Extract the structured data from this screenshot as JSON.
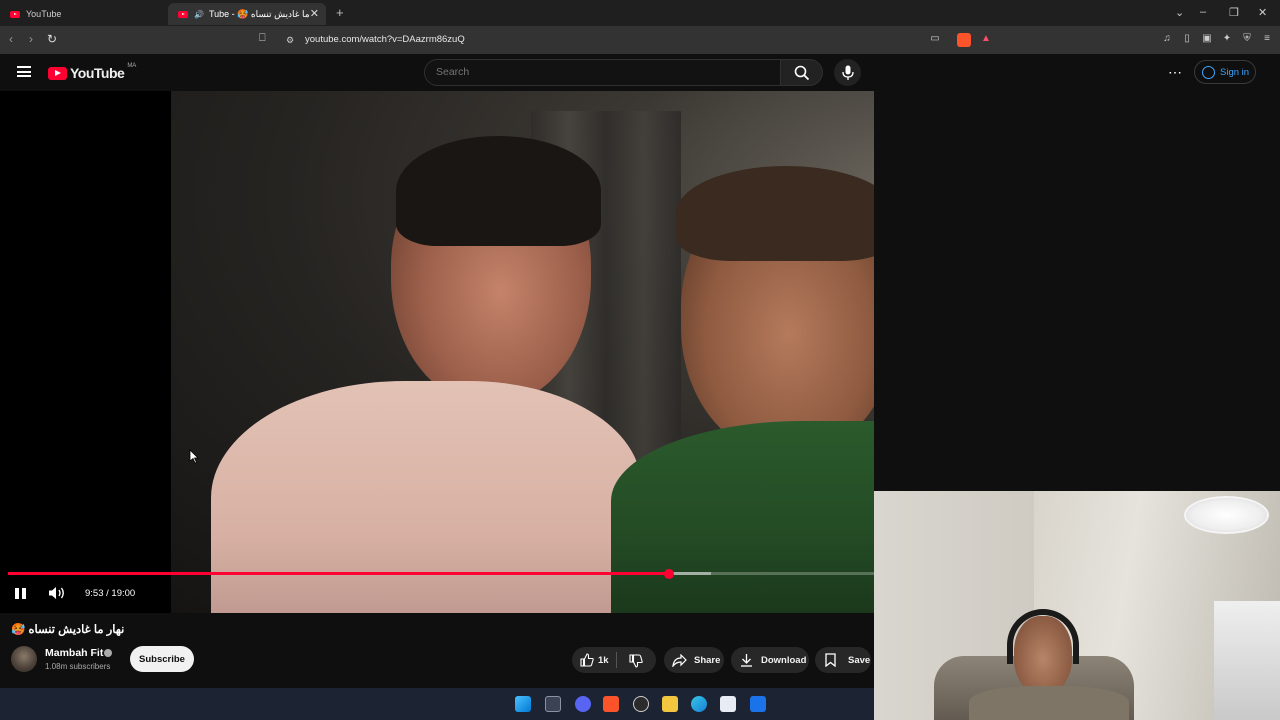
{
  "browser": {
    "tabs": [
      {
        "title": "YouTube"
      },
      {
        "title": "Tube - 🥵 نهار ما غاديش تنساه"
      }
    ],
    "new_tab_symbol": "+",
    "url": "youtube.com/watch?v=DAazrm86zuQ"
  },
  "masthead": {
    "logo_text": "YouTube",
    "region": "MA",
    "search_placeholder": "Search",
    "signin_label": "Sign in"
  },
  "player": {
    "time": "9:53 / 19:00",
    "progress_played_pct": 76.3,
    "progress_buffered_pct": 81.2
  },
  "video": {
    "title": "🥵 نهار ما غاديش تنساه",
    "channel_name": "Mambah Fit",
    "subscribers": "1.08m subscribers",
    "subscribe_label": "Subscribe",
    "like_count": "1k",
    "share_label": "Share",
    "download_label": "Download",
    "save_label": "Save"
  },
  "colors": {
    "youtube_red": "#ff0033",
    "link_blue": "#3ea6ff",
    "background": "#0f0f0f"
  }
}
